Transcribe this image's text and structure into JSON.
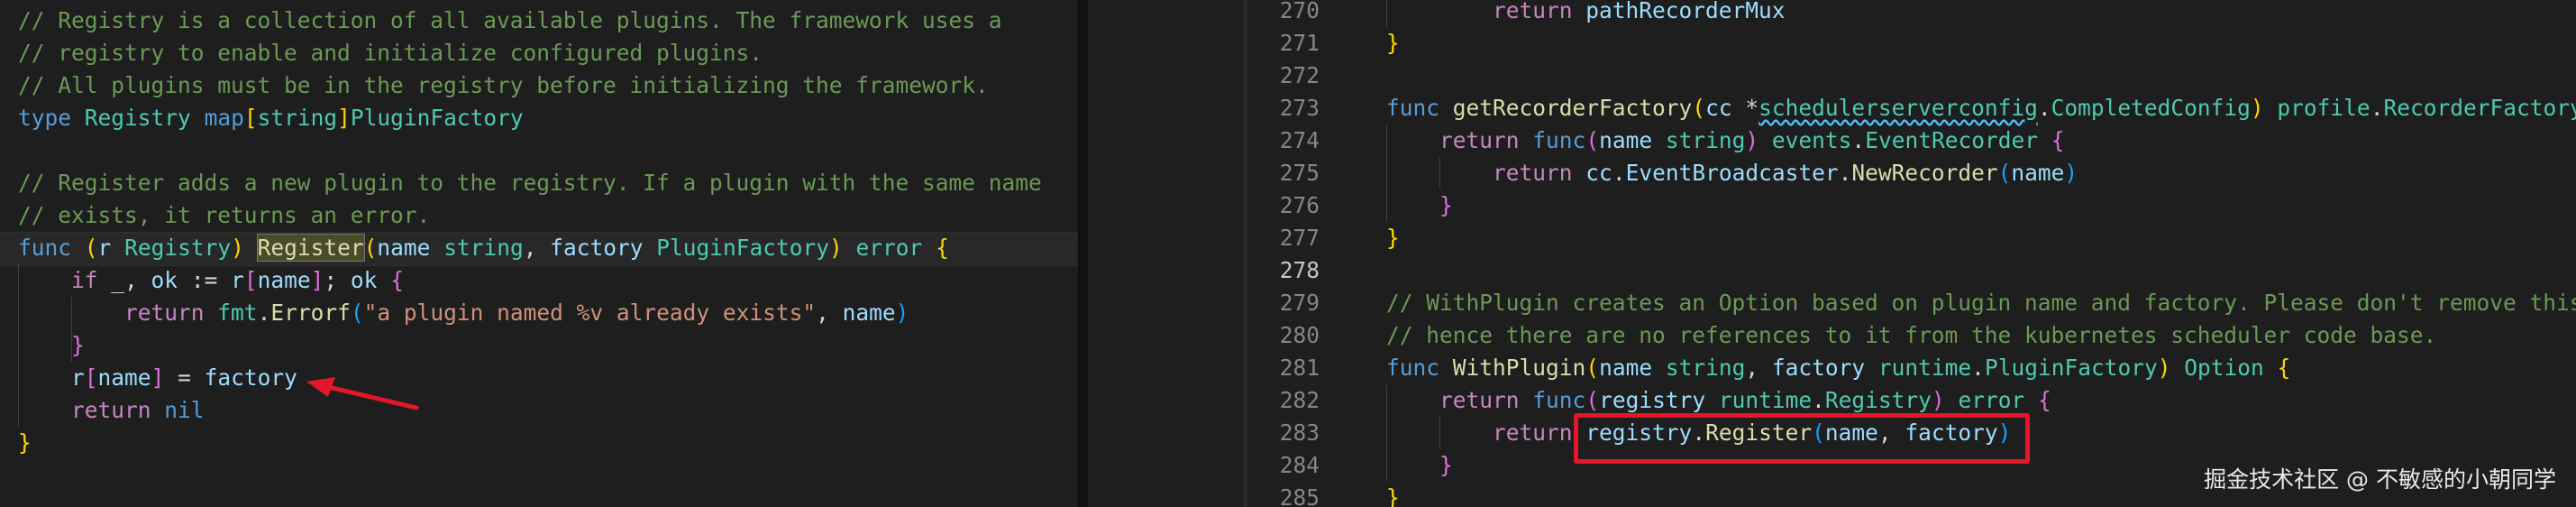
{
  "left_editor": {
    "lines": [
      {
        "tokens": [
          {
            "t": "// Registry is a collection of all available plugins. The framework uses a",
            "c": "c"
          }
        ]
      },
      {
        "tokens": [
          {
            "t": "// registry to enable and initialize configured plugins.",
            "c": "c"
          }
        ]
      },
      {
        "tokens": [
          {
            "t": "// All plugins must be in the registry before initializing the framework.",
            "c": "c"
          }
        ]
      },
      {
        "tokens": [
          {
            "t": "type",
            "c": "kw"
          },
          {
            "t": " ",
            "c": "pn"
          },
          {
            "t": "Registry",
            "c": "ty"
          },
          {
            "t": " ",
            "c": "pn"
          },
          {
            "t": "map",
            "c": "kw"
          },
          {
            "t": "[",
            "c": "br1"
          },
          {
            "t": "string",
            "c": "ty"
          },
          {
            "t": "]",
            "c": "br1"
          },
          {
            "t": "PluginFactory",
            "c": "ty"
          }
        ]
      },
      {
        "tokens": []
      },
      {
        "tokens": [
          {
            "t": "// Register adds a new plugin to the registry. If a plugin with the same name",
            "c": "c"
          }
        ]
      },
      {
        "tokens": [
          {
            "t": "// exists, it returns an error.",
            "c": "c"
          }
        ]
      },
      {
        "active": true,
        "tokens": [
          {
            "t": "func",
            "c": "kw"
          },
          {
            "t": " ",
            "c": "pn"
          },
          {
            "t": "(",
            "c": "br1"
          },
          {
            "t": "r",
            "c": "var"
          },
          {
            "t": " ",
            "c": "pn"
          },
          {
            "t": "Registry",
            "c": "ty"
          },
          {
            "t": ")",
            "c": "br1"
          },
          {
            "t": " ",
            "c": "pn"
          },
          {
            "t": "Register",
            "c": "fn hl"
          },
          {
            "t": "(",
            "c": "br1"
          },
          {
            "t": "name",
            "c": "var"
          },
          {
            "t": " ",
            "c": "pn"
          },
          {
            "t": "string",
            "c": "ty"
          },
          {
            "t": ", ",
            "c": "pn"
          },
          {
            "t": "factory",
            "c": "var"
          },
          {
            "t": " ",
            "c": "pn"
          },
          {
            "t": "PluginFactory",
            "c": "ty"
          },
          {
            "t": ")",
            "c": "br1"
          },
          {
            "t": " ",
            "c": "pn"
          },
          {
            "t": "error",
            "c": "ty"
          },
          {
            "t": " ",
            "c": "pn"
          },
          {
            "t": "{",
            "c": "br1"
          }
        ]
      },
      {
        "tokens": [
          {
            "t": "    ",
            "c": "pn"
          },
          {
            "t": "if",
            "c": "ctl"
          },
          {
            "t": " _, ",
            "c": "pn"
          },
          {
            "t": "ok",
            "c": "var"
          },
          {
            "t": " := ",
            "c": "pn"
          },
          {
            "t": "r",
            "c": "var"
          },
          {
            "t": "[",
            "c": "br2"
          },
          {
            "t": "name",
            "c": "var"
          },
          {
            "t": "]",
            "c": "br2"
          },
          {
            "t": "; ",
            "c": "pn"
          },
          {
            "t": "ok",
            "c": "var"
          },
          {
            "t": " ",
            "c": "pn"
          },
          {
            "t": "{",
            "c": "br2"
          }
        ]
      },
      {
        "tokens": [
          {
            "t": "        ",
            "c": "pn"
          },
          {
            "t": "return",
            "c": "ctl"
          },
          {
            "t": " ",
            "c": "pn"
          },
          {
            "t": "fmt",
            "c": "ty"
          },
          {
            "t": ".",
            "c": "pn"
          },
          {
            "t": "Errorf",
            "c": "fn"
          },
          {
            "t": "(",
            "c": "br3"
          },
          {
            "t": "\"a plugin named %v already exists\"",
            "c": "str"
          },
          {
            "t": ", ",
            "c": "pn"
          },
          {
            "t": "name",
            "c": "var"
          },
          {
            "t": ")",
            "c": "br3"
          }
        ]
      },
      {
        "tokens": [
          {
            "t": "    ",
            "c": "pn"
          },
          {
            "t": "}",
            "c": "br2"
          }
        ]
      },
      {
        "tokens": [
          {
            "t": "    ",
            "c": "pn"
          },
          {
            "t": "r",
            "c": "var"
          },
          {
            "t": "[",
            "c": "br2"
          },
          {
            "t": "name",
            "c": "var"
          },
          {
            "t": "]",
            "c": "br2"
          },
          {
            "t": " = ",
            "c": "pn"
          },
          {
            "t": "factory",
            "c": "var"
          }
        ]
      },
      {
        "tokens": [
          {
            "t": "    ",
            "c": "pn"
          },
          {
            "t": "return",
            "c": "ctl"
          },
          {
            "t": " ",
            "c": "pn"
          },
          {
            "t": "nil",
            "c": "kw"
          }
        ]
      },
      {
        "tokens": [
          {
            "t": "}",
            "c": "br1"
          }
        ]
      }
    ]
  },
  "right_editor": {
    "current_line": "278",
    "lines": [
      {
        "num": "270",
        "tokens": [
          {
            "t": "        ",
            "c": "pn"
          },
          {
            "t": "return",
            "c": "ctl"
          },
          {
            "t": " ",
            "c": "pn"
          },
          {
            "t": "pathRecorderMux",
            "c": "var"
          }
        ]
      },
      {
        "num": "271",
        "tokens": [
          {
            "t": "}",
            "c": "br1"
          }
        ]
      },
      {
        "num": "272",
        "tokens": []
      },
      {
        "num": "273",
        "tokens": [
          {
            "t": "func",
            "c": "kw"
          },
          {
            "t": " ",
            "c": "pn"
          },
          {
            "t": "getRecorderFactory",
            "c": "fn"
          },
          {
            "t": "(",
            "c": "br1"
          },
          {
            "t": "cc",
            "c": "var"
          },
          {
            "t": " *",
            "c": "pn"
          },
          {
            "t": "schedulerserverconfig",
            "c": "ty squig"
          },
          {
            "t": ".",
            "c": "pn"
          },
          {
            "t": "CompletedConfig",
            "c": "ty"
          },
          {
            "t": ")",
            "c": "br1"
          },
          {
            "t": " ",
            "c": "pn"
          },
          {
            "t": "profile",
            "c": "ty"
          },
          {
            "t": ".",
            "c": "pn"
          },
          {
            "t": "RecorderFactory",
            "c": "ty"
          },
          {
            "t": " {",
            "c": "br1"
          }
        ]
      },
      {
        "num": "274",
        "tokens": [
          {
            "t": "    ",
            "c": "pn"
          },
          {
            "t": "return",
            "c": "ctl"
          },
          {
            "t": " ",
            "c": "pn"
          },
          {
            "t": "func",
            "c": "kw"
          },
          {
            "t": "(",
            "c": "br2"
          },
          {
            "t": "name",
            "c": "var"
          },
          {
            "t": " ",
            "c": "pn"
          },
          {
            "t": "string",
            "c": "ty"
          },
          {
            "t": ")",
            "c": "br2"
          },
          {
            "t": " ",
            "c": "pn"
          },
          {
            "t": "events",
            "c": "ty"
          },
          {
            "t": ".",
            "c": "pn"
          },
          {
            "t": "EventRecorder",
            "c": "ty"
          },
          {
            "t": " ",
            "c": "pn"
          },
          {
            "t": "{",
            "c": "br2"
          }
        ]
      },
      {
        "num": "275",
        "tokens": [
          {
            "t": "        ",
            "c": "pn"
          },
          {
            "t": "return",
            "c": "ctl"
          },
          {
            "t": " ",
            "c": "pn"
          },
          {
            "t": "cc",
            "c": "var"
          },
          {
            "t": ".",
            "c": "pn"
          },
          {
            "t": "EventBroadcaster",
            "c": "var"
          },
          {
            "t": ".",
            "c": "pn"
          },
          {
            "t": "NewRecorder",
            "c": "fn"
          },
          {
            "t": "(",
            "c": "br3"
          },
          {
            "t": "name",
            "c": "var"
          },
          {
            "t": ")",
            "c": "br3"
          }
        ]
      },
      {
        "num": "276",
        "tokens": [
          {
            "t": "    ",
            "c": "pn"
          },
          {
            "t": "}",
            "c": "br2"
          }
        ]
      },
      {
        "num": "277",
        "tokens": [
          {
            "t": "}",
            "c": "br1"
          }
        ]
      },
      {
        "num": "278",
        "tokens": []
      },
      {
        "num": "279",
        "tokens": [
          {
            "t": "// WithPlugin creates an Option based on plugin name and factory. Please don't remove this f",
            "c": "c"
          }
        ]
      },
      {
        "num": "280",
        "tokens": [
          {
            "t": "// hence there are no references to it from the kubernetes scheduler code base.",
            "c": "c"
          }
        ]
      },
      {
        "num": "281",
        "tokens": [
          {
            "t": "func",
            "c": "kw"
          },
          {
            "t": " ",
            "c": "pn"
          },
          {
            "t": "WithPlugin",
            "c": "fn"
          },
          {
            "t": "(",
            "c": "br1"
          },
          {
            "t": "name",
            "c": "var"
          },
          {
            "t": " ",
            "c": "pn"
          },
          {
            "t": "string",
            "c": "ty"
          },
          {
            "t": ", ",
            "c": "pn"
          },
          {
            "t": "factory",
            "c": "var"
          },
          {
            "t": " ",
            "c": "pn"
          },
          {
            "t": "runtime",
            "c": "ty"
          },
          {
            "t": ".",
            "c": "pn"
          },
          {
            "t": "PluginFactory",
            "c": "ty"
          },
          {
            "t": ")",
            "c": "br1"
          },
          {
            "t": " ",
            "c": "pn"
          },
          {
            "t": "Option",
            "c": "ty"
          },
          {
            "t": " ",
            "c": "pn"
          },
          {
            "t": "{",
            "c": "br1"
          }
        ]
      },
      {
        "num": "282",
        "tokens": [
          {
            "t": "    ",
            "c": "pn"
          },
          {
            "t": "return",
            "c": "ctl"
          },
          {
            "t": " ",
            "c": "pn"
          },
          {
            "t": "func",
            "c": "kw"
          },
          {
            "t": "(",
            "c": "br2"
          },
          {
            "t": "registry",
            "c": "var"
          },
          {
            "t": " ",
            "c": "pn"
          },
          {
            "t": "runtime",
            "c": "ty"
          },
          {
            "t": ".",
            "c": "pn"
          },
          {
            "t": "Registry",
            "c": "ty"
          },
          {
            "t": ")",
            "c": "br2"
          },
          {
            "t": " ",
            "c": "pn"
          },
          {
            "t": "error",
            "c": "ty"
          },
          {
            "t": " ",
            "c": "pn"
          },
          {
            "t": "{",
            "c": "br2"
          }
        ]
      },
      {
        "num": "283",
        "tokens": [
          {
            "t": "        ",
            "c": "pn"
          },
          {
            "t": "return",
            "c": "ctl"
          },
          {
            "t": " ",
            "c": "pn"
          },
          {
            "t": "registry",
            "c": "var"
          },
          {
            "t": ".",
            "c": "pn"
          },
          {
            "t": "Register",
            "c": "fn"
          },
          {
            "t": "(",
            "c": "br3"
          },
          {
            "t": "name",
            "c": "var"
          },
          {
            "t": ", ",
            "c": "pn"
          },
          {
            "t": "factory",
            "c": "var"
          },
          {
            "t": ")",
            "c": "br3"
          }
        ]
      },
      {
        "num": "284",
        "tokens": [
          {
            "t": "    ",
            "c": "pn"
          },
          {
            "t": "}",
            "c": "br2"
          }
        ]
      },
      {
        "num": "285",
        "tokens": [
          {
            "t": "}",
            "c": "br1"
          }
        ]
      }
    ]
  },
  "annotations": {
    "arrow_color": "#e5162a",
    "box_color": "#e5162a"
  },
  "watermark": "掘金技术社区 @ 不敏感的小朝同学",
  "colors": {
    "background": "#1e1e1e",
    "comment": "#6a9955",
    "keyword": "#569cd6",
    "control": "#c586c0",
    "type": "#4ec9b0",
    "function": "#dcdcaa",
    "variable": "#9cdcfe",
    "string": "#ce9178"
  }
}
